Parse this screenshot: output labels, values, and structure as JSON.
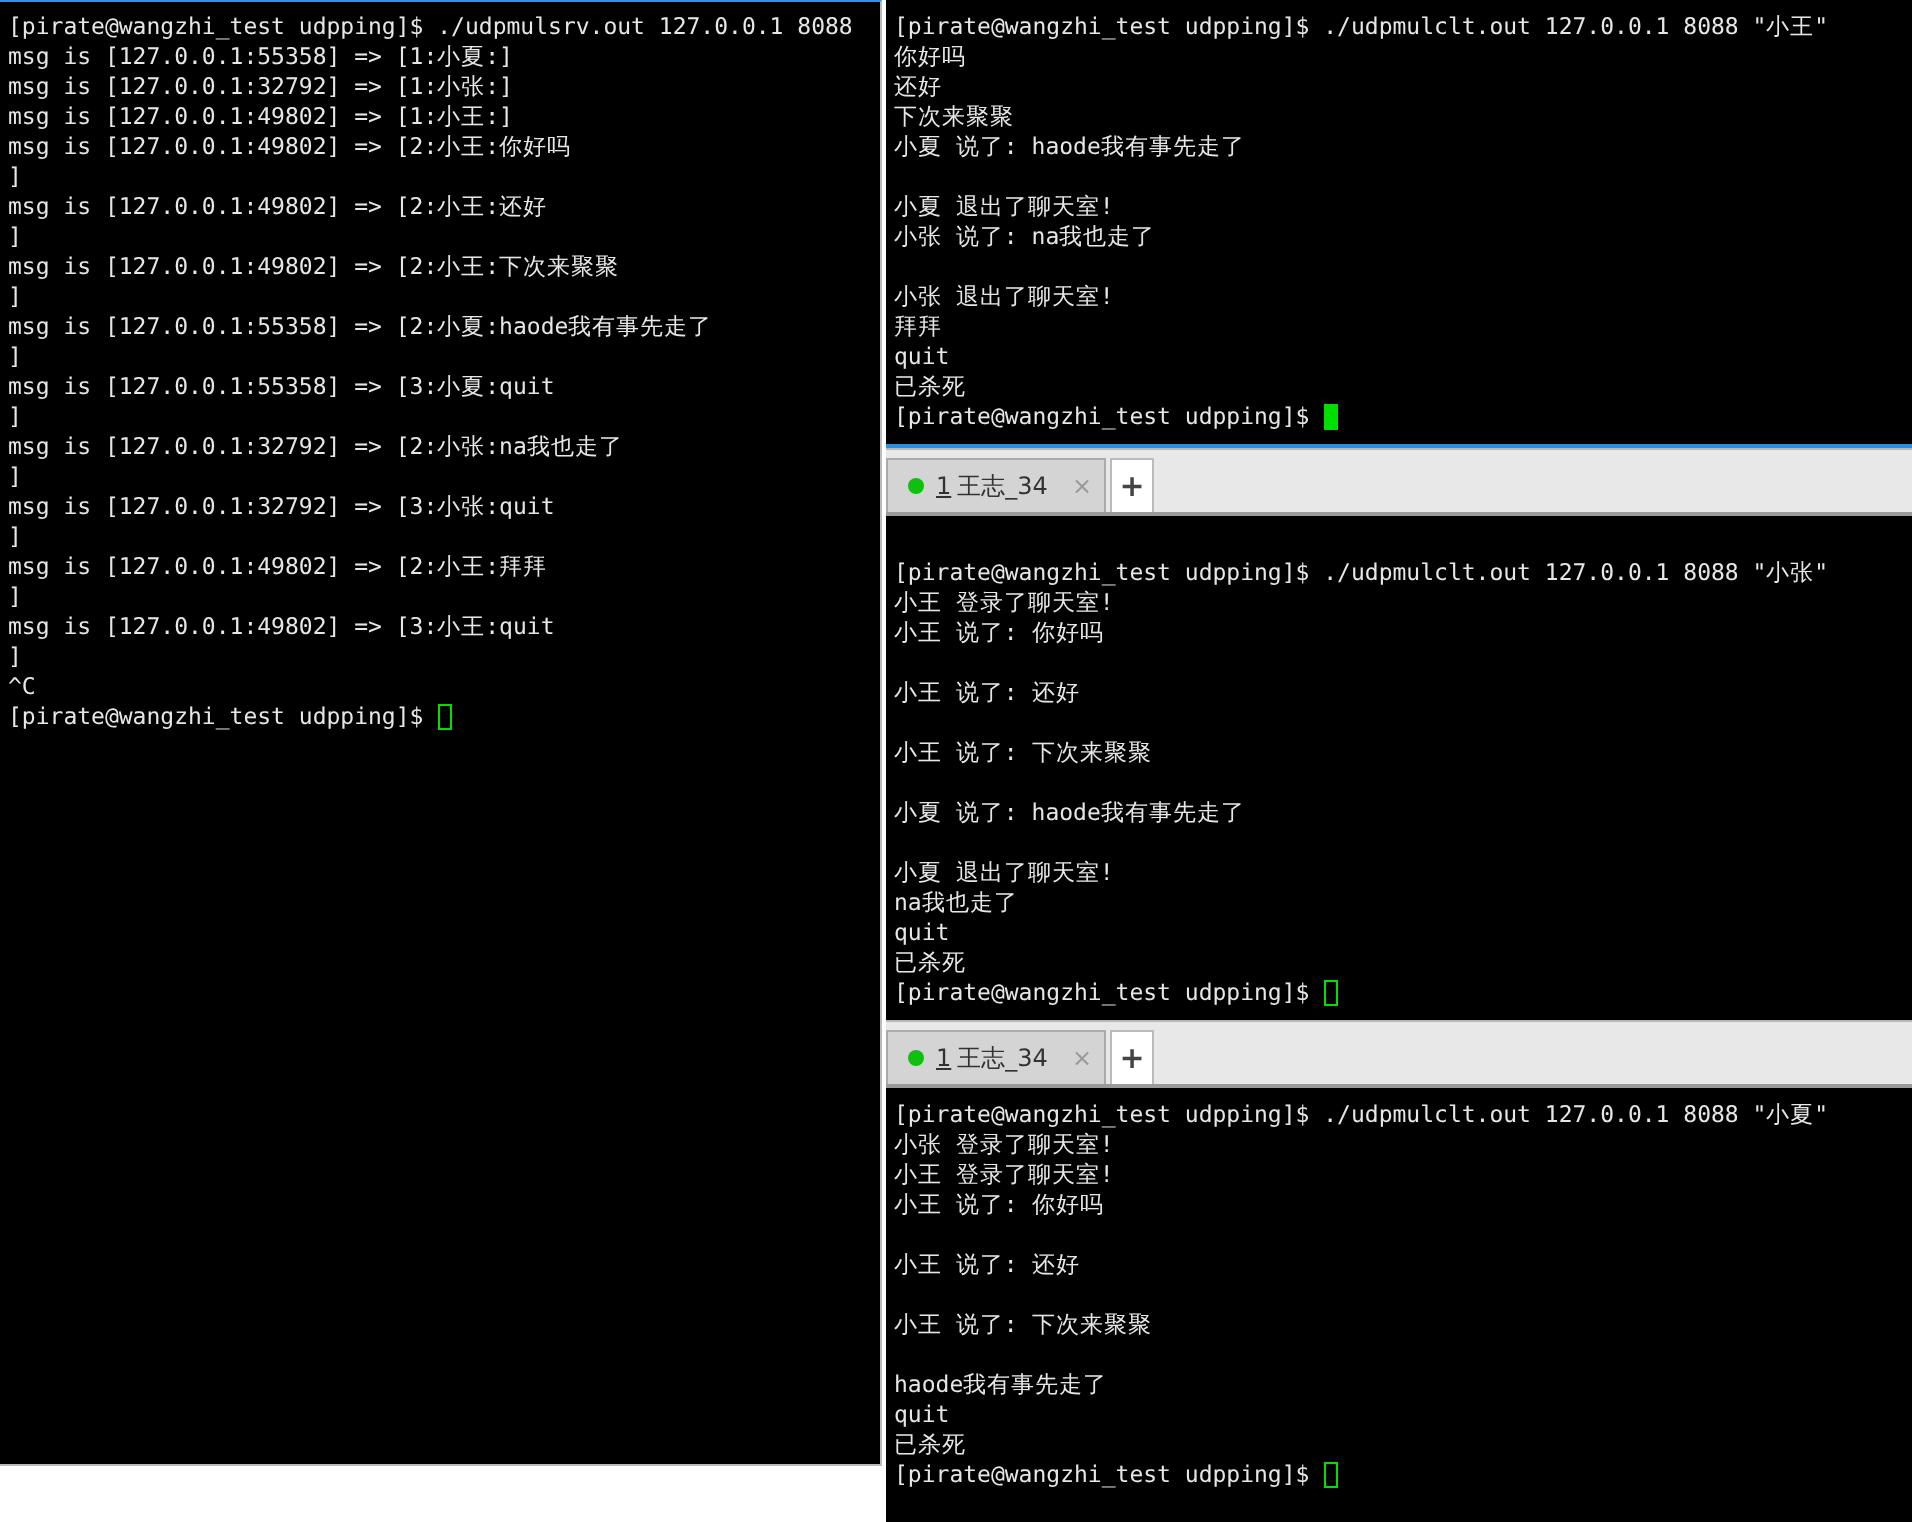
{
  "left_terminal": {
    "focused": false,
    "lines": [
      {
        "kind": "text",
        "text": "[pirate@wangzhi_test udpping]$ ./udpmulsrv.out 127.0.0.1 8088"
      },
      {
        "kind": "text",
        "text": "msg is [127.0.0.1:55358] => [1:小夏:]"
      },
      {
        "kind": "text",
        "text": "msg is [127.0.0.1:32792] => [1:小张:]"
      },
      {
        "kind": "text",
        "text": "msg is [127.0.0.1:49802] => [1:小王:]"
      },
      {
        "kind": "text",
        "text": "msg is [127.0.0.1:49802] => [2:小王:你好吗"
      },
      {
        "kind": "text",
        "text": "]"
      },
      {
        "kind": "text",
        "text": "msg is [127.0.0.1:49802] => [2:小王:还好"
      },
      {
        "kind": "text",
        "text": "]"
      },
      {
        "kind": "text",
        "text": "msg is [127.0.0.1:49802] => [2:小王:下次来聚聚"
      },
      {
        "kind": "text",
        "text": "]"
      },
      {
        "kind": "text",
        "text": "msg is [127.0.0.1:55358] => [2:小夏:haode我有事先走了"
      },
      {
        "kind": "text",
        "text": "]"
      },
      {
        "kind": "text",
        "text": "msg is [127.0.0.1:55358] => [3:小夏:quit"
      },
      {
        "kind": "text",
        "text": "]"
      },
      {
        "kind": "text",
        "text": "msg is [127.0.0.1:32792] => [2:小张:na我也走了"
      },
      {
        "kind": "text",
        "text": "]"
      },
      {
        "kind": "text",
        "text": "msg is [127.0.0.1:32792] => [3:小张:quit"
      },
      {
        "kind": "text",
        "text": "]"
      },
      {
        "kind": "text",
        "text": "msg is [127.0.0.1:49802] => [2:小王:拜拜"
      },
      {
        "kind": "text",
        "text": "]"
      },
      {
        "kind": "text",
        "text": "msg is [127.0.0.1:49802] => [3:小王:quit"
      },
      {
        "kind": "text",
        "text": "]"
      },
      {
        "kind": "text",
        "text": "^C"
      },
      {
        "kind": "prompt",
        "text": "[pirate@wangzhi_test udpping]$"
      }
    ]
  },
  "right_panes": [
    {
      "terminal": {
        "focused": true,
        "lines": [
          {
            "kind": "text",
            "text": "[pirate@wangzhi_test udpping]$ ./udpmulclt.out 127.0.0.1 8088 \"小王\""
          },
          {
            "kind": "text",
            "text": "你好吗"
          },
          {
            "kind": "text",
            "text": "还好"
          },
          {
            "kind": "text",
            "text": "下次来聚聚"
          },
          {
            "kind": "text",
            "text": "小夏 说了: haode我有事先走了"
          },
          {
            "kind": "blank"
          },
          {
            "kind": "text",
            "text": "小夏 退出了聊天室!"
          },
          {
            "kind": "text",
            "text": "小张 说了: na我也走了"
          },
          {
            "kind": "blank"
          },
          {
            "kind": "text",
            "text": "小张 退出了聊天室!"
          },
          {
            "kind": "text",
            "text": "拜拜"
          },
          {
            "kind": "text",
            "text": "quit"
          },
          {
            "kind": "text",
            "text": "已杀死"
          },
          {
            "kind": "prompt",
            "text": "[pirate@wangzhi_test udpping]$"
          }
        ]
      }
    },
    {
      "tab": {
        "number": "1",
        "label": "王志_34",
        "close": "×"
      },
      "new_tab": "+",
      "terminal": {
        "focused": false,
        "lines": [
          {
            "kind": "blank"
          },
          {
            "kind": "text",
            "text": "[pirate@wangzhi_test udpping]$ ./udpmulclt.out 127.0.0.1 8088 \"小张\""
          },
          {
            "kind": "text",
            "text": "小王 登录了聊天室!"
          },
          {
            "kind": "text",
            "text": "小王 说了: 你好吗"
          },
          {
            "kind": "blank"
          },
          {
            "kind": "text",
            "text": "小王 说了: 还好"
          },
          {
            "kind": "blank"
          },
          {
            "kind": "text",
            "text": "小王 说了: 下次来聚聚"
          },
          {
            "kind": "blank"
          },
          {
            "kind": "text",
            "text": "小夏 说了: haode我有事先走了"
          },
          {
            "kind": "blank"
          },
          {
            "kind": "text",
            "text": "小夏 退出了聊天室!"
          },
          {
            "kind": "text",
            "text": "na我也走了"
          },
          {
            "kind": "text",
            "text": "quit"
          },
          {
            "kind": "text",
            "text": "已杀死"
          },
          {
            "kind": "prompt",
            "text": "[pirate@wangzhi_test udpping]$"
          }
        ]
      }
    },
    {
      "tab": {
        "number": "1",
        "label": "王志_34",
        "close": "×"
      },
      "new_tab": "+",
      "terminal": {
        "focused": false,
        "lines": [
          {
            "kind": "text",
            "text": "[pirate@wangzhi_test udpping]$ ./udpmulclt.out 127.0.0.1 8088 \"小夏\""
          },
          {
            "kind": "text",
            "text": "小张 登录了聊天室!"
          },
          {
            "kind": "text",
            "text": "小王 登录了聊天室!"
          },
          {
            "kind": "text",
            "text": "小王 说了: 你好吗"
          },
          {
            "kind": "blank"
          },
          {
            "kind": "text",
            "text": "小王 说了: 还好"
          },
          {
            "kind": "blank"
          },
          {
            "kind": "text",
            "text": "小王 说了: 下次来聚聚"
          },
          {
            "kind": "blank"
          },
          {
            "kind": "text",
            "text": "haode我有事先走了"
          },
          {
            "kind": "text",
            "text": "quit"
          },
          {
            "kind": "text",
            "text": "已杀死"
          },
          {
            "kind": "prompt",
            "text": "[pirate@wangzhi_test udpping]$"
          }
        ]
      }
    }
  ]
}
